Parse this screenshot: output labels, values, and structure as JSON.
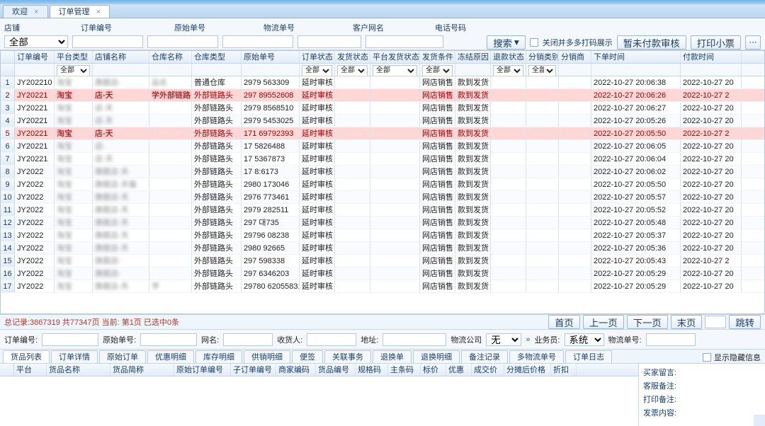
{
  "tabs": {
    "t0": "欢迎",
    "t1": "订单管理"
  },
  "filters": {
    "shop": "店铺",
    "shop_all": "全部",
    "orderNo": "订单编号",
    "origNo": "原始单号",
    "logiNo": "物流单号",
    "custName": "客户网名",
    "phone": "电话号码"
  },
  "buttons": {
    "search": "搜索",
    "searchArrow": "▾",
    "closeExtra": "关闭并多多打码展示",
    "auditPay": "暂未付款审核",
    "printSmall": "打印小票"
  },
  "grid": {
    "headers": {
      "orderid": "订单编号",
      "plattype": "平台类型",
      "shopname": "店铺名称",
      "warehouse": "仓库名称",
      "whtype": "仓库类型",
      "orig": "原始单号",
      "ordstate": "订单状态",
      "shipstate": "发货状态",
      "platship": "平台发货状态",
      "shipcond": "发货条件",
      "freeze": "冻结原因",
      "refund": "退款状态",
      "disttype": "分销类别",
      "dist": "分销商",
      "time1": "下单时间",
      "time2": "付款时间"
    },
    "filter_all": "全部",
    "rows": [
      {
        "n": "1",
        "hl": false,
        "id": "JY202210",
        "plat": "淘宝",
        "shop": "旗舰店-",
        "wh": "品名",
        "wht": "普通仓库",
        "orig": "2979       563309",
        "st": "延时审核",
        "ship": "",
        "pship": "",
        "cond": "网店销售",
        "cond2": "款到发货",
        "t1": "2022-10-27 20:06:38",
        "t2": "2022-10-27 20"
      },
      {
        "n": "2",
        "hl": true,
        "id": "JY20221",
        "plat": "淘宝",
        "shop": "店-天",
        "wh": "学外部链路头",
        "wht": "外部链路头",
        "orig": "297        89552608",
        "st": "延时审核",
        "ship": "",
        "pship": "",
        "cond": "网店销售",
        "cond2": "款到发货",
        "t1": "2022-10-27 20:06:26",
        "t2": "2022-10-27 2"
      },
      {
        "n": "3",
        "hl": false,
        "id": "JY20221",
        "plat": "淘宝",
        "shop": "店-天",
        "wh": "",
        "wht": "外部链路头",
        "orig": "2979       8568510",
        "st": "延时审核",
        "ship": "",
        "pship": "",
        "cond": "网店销售",
        "cond2": "款到发货",
        "t1": "2022-10-27 20:06:27",
        "t2": "2022-10-27 20"
      },
      {
        "n": "4",
        "hl": false,
        "id": "JY20221",
        "plat": "淘宝",
        "shop": "店-天",
        "wh": "",
        "wht": "外部链路头",
        "orig": "2979       5453025",
        "st": "延时审核",
        "ship": "",
        "pship": "",
        "cond": "网店销售",
        "cond2": "款到发货",
        "t1": "2022-10-27 20:05:26",
        "t2": "2022-10-27 20"
      },
      {
        "n": "5",
        "hl": true,
        "id": "JY20221",
        "plat": "淘宝",
        "shop": "店-天",
        "wh": "",
        "wht": "外部链路头",
        "orig": "171        69792393",
        "st": "延时审核",
        "ship": "",
        "pship": "",
        "cond": "网店销售",
        "cond2": "款到发货",
        "t1": "2022-10-27 20:05:50",
        "t2": "2022-10-27 2"
      },
      {
        "n": "6",
        "hl": false,
        "id": "JY20221",
        "plat": "淘宝",
        "shop": "店-",
        "wh": "",
        "wht": "外部链路头",
        "orig": "17         5826488",
        "st": "延时审核",
        "ship": "",
        "pship": "",
        "cond": "网店销售",
        "cond2": "款到发货",
        "t1": "2022-10-27 20:06:05",
        "t2": "2022-10-27 20"
      },
      {
        "n": "7",
        "hl": false,
        "id": "JY20221",
        "plat": "淘宝",
        "shop": "店-天",
        "wh": "",
        "wht": "外部链路头",
        "orig": "17         5367873",
        "st": "延时审核",
        "ship": "",
        "pship": "",
        "cond": "网店销售",
        "cond2": "款到发货",
        "t1": "2022-10-27 20:06:04",
        "t2": "2022-10-27 20"
      },
      {
        "n": "8",
        "hl": false,
        "id": "JY2022",
        "plat": "淘宝",
        "shop": "旗舰店-天",
        "wh": "",
        "wht": "外部链路头",
        "orig": "17         8:6173",
        "st": "延时审核",
        "ship": "",
        "pship": "",
        "cond": "网店销售",
        "cond2": "款到发货",
        "t1": "2022-10-27 20:06:02",
        "t2": "2022-10-27 20"
      },
      {
        "n": "9",
        "hl": false,
        "id": "JY2022",
        "plat": "淘宝",
        "shop": "旗舰店-天猫",
        "wh": "",
        "wht": "外部链路头",
        "orig": "2980       173046",
        "st": "延时审核",
        "ship": "",
        "pship": "",
        "cond": "网店销售",
        "cond2": "款到发货",
        "t1": "2022-10-27 20:05:50",
        "t2": "2022-10-27 20"
      },
      {
        "n": "10",
        "hl": false,
        "id": "JY2022",
        "plat": "淘宝",
        "shop": "旗舰店-天",
        "wh": "",
        "wht": "外部链路头",
        "orig": "2976       773461",
        "st": "延时审核",
        "ship": "",
        "pship": "",
        "cond": "网店销售",
        "cond2": "款到发货",
        "t1": "2022-10-27 20:05:57",
        "t2": "2022-10-27 20"
      },
      {
        "n": "11",
        "hl": false,
        "id": "JY2022",
        "plat": "淘宝",
        "shop": "旗舰店-天",
        "wh": "",
        "wht": "外部链路头",
        "orig": "2979       282511",
        "st": "延时审核",
        "ship": "",
        "pship": "",
        "cond": "网店销售",
        "cond2": "款到发货",
        "t1": "2022-10-27 20:05:52",
        "t2": "2022-10-27 20"
      },
      {
        "n": "12",
        "hl": false,
        "id": "JY2022",
        "plat": "淘宝",
        "shop": "旗舰店-天",
        "wh": "",
        "wht": "外部链路头",
        "orig": "297        대735",
        "st": "延时审核",
        "ship": "",
        "pship": "",
        "cond": "网店销售",
        "cond2": "款到发货",
        "t1": "2022-10-27 20:05:48",
        "t2": "2022-10-27 20"
      },
      {
        "n": "13",
        "hl": false,
        "id": "JY2022",
        "plat": "淘宝",
        "shop": "旗舰店-天",
        "wh": "",
        "wht": "外部链路头",
        "orig": "29796      08238",
        "st": "延时审核",
        "ship": "",
        "pship": "",
        "cond": "网店销售",
        "cond2": "款到发货",
        "t1": "2022-10-27 20:05:37",
        "t2": "2022-10-27 20"
      },
      {
        "n": "14",
        "hl": false,
        "id": "JY2022",
        "plat": "淘宝",
        "shop": "旗舰店-天",
        "wh": "",
        "wht": "外部链路头",
        "orig": "2980       92665",
        "st": "延时审核",
        "ship": "",
        "pship": "",
        "cond": "网店销售",
        "cond2": "款到发货",
        "t1": "2022-10-27 20:05:36",
        "t2": "2022-10-27 20"
      },
      {
        "n": "15",
        "hl": false,
        "id": "JY2022",
        "plat": "淘宝",
        "shop": "旗舰店-",
        "wh": "",
        "wht": "外部链路头",
        "orig": "297        598338",
        "st": "延时审核",
        "ship": "",
        "pship": "",
        "cond": "网店销售",
        "cond2": "款到发货",
        "t1": "2022-10-27 20:05:43",
        "t2": "2022-10-27 2"
      },
      {
        "n": "16",
        "hl": false,
        "id": "JY2022",
        "plat": "淘宝",
        "shop": "旗舰店-",
        "wh": "",
        "wht": "外部链路头",
        "orig": "297        6346203",
        "st": "延时审核",
        "ship": "",
        "pship": "",
        "cond": "网店销售",
        "cond2": "款到发货",
        "t1": "2022-10-27 20:05:29",
        "t2": "2022-10-27 20"
      },
      {
        "n": "17",
        "hl": false,
        "id": "JY2022",
        "plat": "淘宝",
        "shop": "旗舰店-天",
        "wh": "学",
        "wht": "外部链路头",
        "orig": "29780      620558314",
        "st": "延时审核",
        "ship": "",
        "pship": "",
        "cond": "网店销售",
        "cond2": "款到发货",
        "t1": "2022-10-27 20:05:29",
        "t2": "2022-10-27 20"
      }
    ]
  },
  "status": {
    "text": "总记录:3867319  共77347页  当前: 第1页  已选中0条",
    "first": "首页",
    "prev": "上一页",
    "next": "下一页",
    "last": "末页",
    "jump": "跳转"
  },
  "filters2": {
    "orderNo": "订单编号:",
    "origNo": "原始单号:",
    "netName": "网名:",
    "recv": "收货人:",
    "addr": "地址:",
    "logi": "物流公司",
    "logi_val": "无",
    "arrow": "»",
    "staff": "业务员:",
    "staff_val": "系统",
    "logiNo": "物流单号:"
  },
  "innerTabs": {
    "t0": "货品列表",
    "t1": "订单详情",
    "t2": "原始订单",
    "t3": "优惠明细",
    "t4": "库存明细",
    "t5": "供销明细",
    "t6": "便签",
    "t7": "关联事务",
    "t8": "退换单",
    "t9": "退换明细",
    "t10": "备注记录",
    "t11": "多物流单号",
    "t12": "订单日志",
    "showHidden": "显示隐藏信息"
  },
  "detail": {
    "headers": {
      "c0": "平台",
      "c1": "货品名称",
      "c2": "货品简称",
      "c3": "原始订单编号",
      "c4": "子订单编号",
      "c5": "商家编码",
      "c6": "货品编号",
      "c7": "规格码",
      "c8": "主条码",
      "c9": "标价",
      "c10": "优惠",
      "c11": "成交价",
      "c12": "分摊后价格",
      "c13": "折扣"
    }
  },
  "remarks": {
    "buyer": "买家留言:",
    "cs": "客服备注:",
    "print": "打印备注:",
    "invoice": "发票内容:"
  }
}
